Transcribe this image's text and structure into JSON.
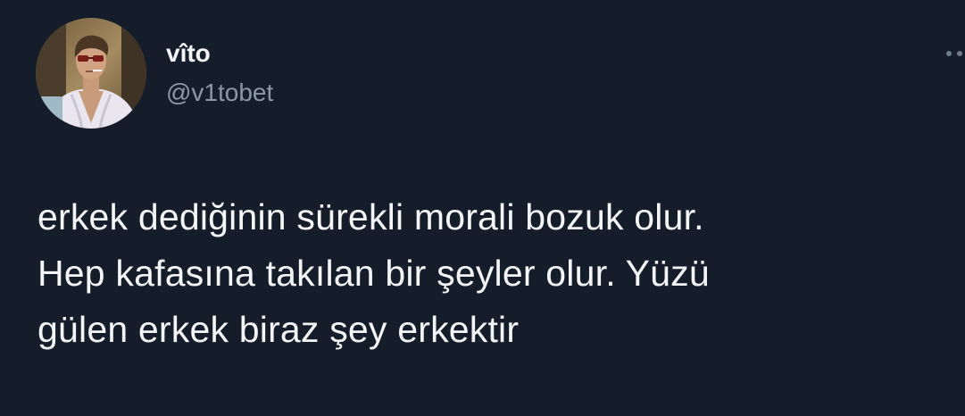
{
  "tweet": {
    "author": {
      "display_name": "vîto",
      "handle": "@v1tobet",
      "avatar": "profile-photo"
    },
    "more_icon": "more-horizontal-icon",
    "text": "erkek dediğinin sürekli morali bozuk olur.\nHep kafasına takılan bir şeyler olur. Yüzü\ngülen erkek biraz şey erkektir"
  },
  "colors": {
    "background": "#161d2a",
    "primary_text": "#f3f5f7",
    "secondary_text": "#8b98a5"
  }
}
